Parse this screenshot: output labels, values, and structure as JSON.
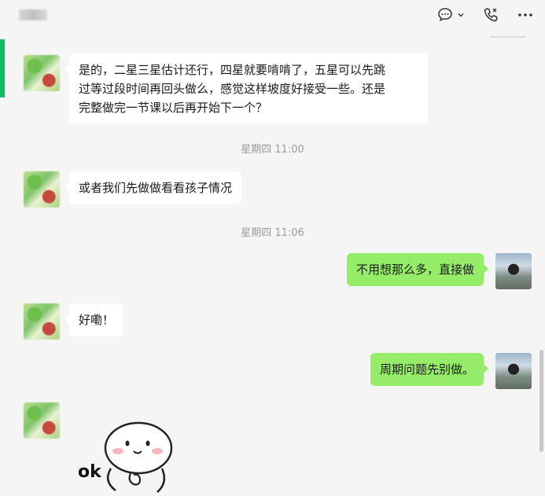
{
  "header": {
    "title": "",
    "icons": [
      "chat-bubble-icon",
      "chevron-down-icon",
      "phone-icon",
      "more-icon"
    ]
  },
  "colors": {
    "accent": "#07c160",
    "outgoing_bubble": "#95ec69",
    "incoming_bubble": "#ffffff",
    "background": "#f5f5f5",
    "timestamp": "#9b9b9b"
  },
  "messages": [
    {
      "side": "left",
      "type": "text",
      "lines": [
        "是的，二星三星估计还行，四星就要啃啃了，五星可以先跳",
        "过等过段时间再回头做么，感觉这样坡度好接受一些。还是",
        "完整做完一节课以后再开始下一个？"
      ]
    },
    {
      "type": "time",
      "text": "星期四 11:00"
    },
    {
      "side": "left",
      "type": "text",
      "lines": [
        "或者我们先做做看看孩子情况"
      ]
    },
    {
      "type": "time",
      "text": "星期四 11:06"
    },
    {
      "side": "right",
      "type": "text",
      "lines": [
        "不用想那么多，直接做"
      ]
    },
    {
      "side": "left",
      "type": "text",
      "lines": [
        "好嘞！"
      ]
    },
    {
      "side": "right",
      "type": "text",
      "lines": [
        "周期问题先别做。"
      ]
    },
    {
      "side": "left",
      "type": "sticker",
      "caption": "ok"
    }
  ]
}
